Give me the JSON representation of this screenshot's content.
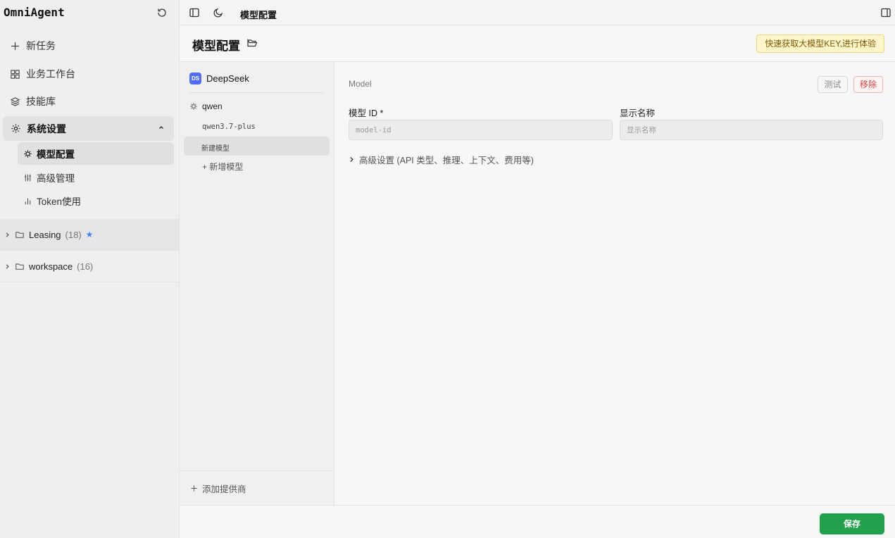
{
  "app": {
    "name": "OmniAgent"
  },
  "sidebar": {
    "new_task": "新任务",
    "workbench": "业务工作台",
    "skills": "技能库",
    "settings": {
      "label": "系统设置",
      "children": [
        "模型配置",
        "高级管理",
        "Token使用"
      ]
    },
    "folders": [
      {
        "name": "Leasing",
        "count": "(18)",
        "starred": true,
        "star": "★"
      },
      {
        "name": "workspace",
        "count": "(16)",
        "starred": false,
        "star": ""
      }
    ]
  },
  "topbar": {
    "title": "模型配置"
  },
  "header": {
    "title": "模型配置",
    "promo": "快速获取大模型KEY,进行体验"
  },
  "providers": {
    "deepseek": {
      "badge": "DS",
      "name": "DeepSeek"
    },
    "qwen": {
      "name": "qwen",
      "models": [
        "qwen3.7-plus",
        "新建模型"
      ],
      "add_model": "+ 新增模型"
    },
    "add_provider": "添加提供商"
  },
  "model": {
    "section": "Model",
    "test": "测试",
    "remove": "移除",
    "id_label": "模型 ID *",
    "id_placeholder": "model-id",
    "name_label": "显示名称",
    "name_placeholder": "显示名称",
    "advanced": "高级设置 (API 类型、推理、上下文、费用等)"
  },
  "footer": {
    "save": "保存"
  },
  "colors": {
    "accent": "#22a04b",
    "danger": "#d64545",
    "promo_bg": "#fff6cc",
    "ds_badge": "#4f6df5",
    "star": "#3b82f6"
  }
}
